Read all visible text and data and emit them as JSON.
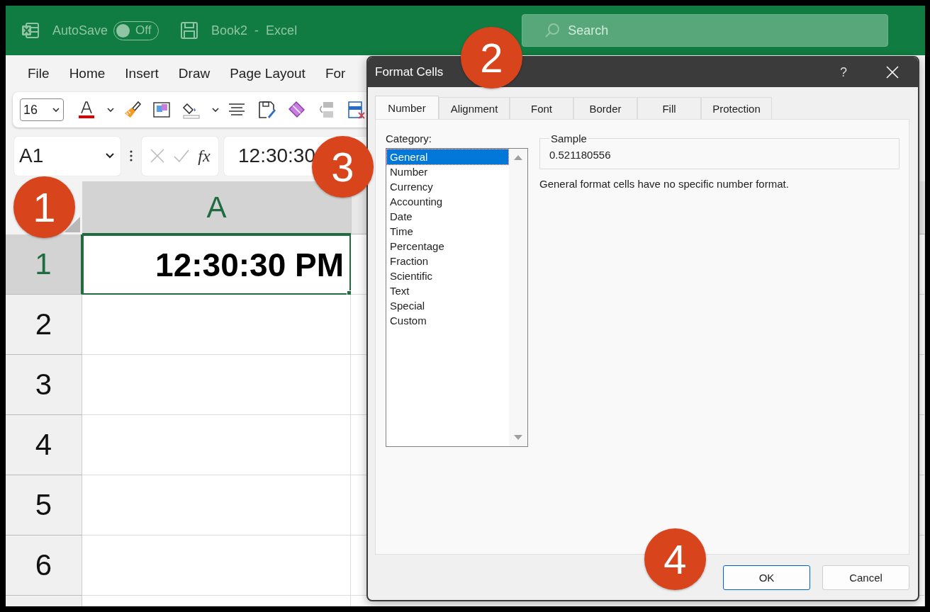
{
  "title_bar": {
    "autosave_label": "AutoSave",
    "autosave": {
      "on": false,
      "label": "Off"
    },
    "document": "Book2",
    "separator": "-",
    "app": "Excel",
    "search": {
      "placeholder": "Search"
    }
  },
  "menu": [
    {
      "label": "File"
    },
    {
      "label": "Home"
    },
    {
      "label": "Insert"
    },
    {
      "label": "Draw"
    },
    {
      "label": "Page Layout"
    },
    {
      "label": "For"
    }
  ],
  "toolbar": {
    "font_size": "16"
  },
  "formula_bar": {
    "name_box": "A1",
    "function_label": "fx",
    "value": "12:30:30"
  },
  "sheet": {
    "columns": [
      {
        "label": "A",
        "selected": true
      }
    ],
    "rows": [
      {
        "label": "1",
        "selected": true,
        "value": "12:30:30 PM"
      },
      {
        "label": "2",
        "selected": false
      },
      {
        "label": "3",
        "selected": false
      },
      {
        "label": "4",
        "selected": false
      },
      {
        "label": "5",
        "selected": false
      },
      {
        "label": "6",
        "selected": false
      }
    ]
  },
  "dialog": {
    "title": "Format Cells",
    "help": "?",
    "tabs": [
      {
        "label": "Number",
        "selected": true
      },
      {
        "label": "Alignment",
        "selected": false
      },
      {
        "label": "Font",
        "selected": false
      },
      {
        "label": "Border",
        "selected": false
      },
      {
        "label": "Fill",
        "selected": false
      },
      {
        "label": "Protection",
        "selected": false
      }
    ],
    "category_label": "Category:",
    "categories": [
      {
        "label": "General",
        "selected": true
      },
      {
        "label": "Number",
        "selected": false
      },
      {
        "label": "Currency",
        "selected": false
      },
      {
        "label": "Accounting",
        "selected": false
      },
      {
        "label": "Date",
        "selected": false
      },
      {
        "label": "Time",
        "selected": false
      },
      {
        "label": "Percentage",
        "selected": false
      },
      {
        "label": "Fraction",
        "selected": false
      },
      {
        "label": "Scientific",
        "selected": false
      },
      {
        "label": "Text",
        "selected": false
      },
      {
        "label": "Special",
        "selected": false
      },
      {
        "label": "Custom",
        "selected": false
      }
    ],
    "sample": {
      "label": "Sample",
      "value": "0.521180556"
    },
    "description": "General format cells have no specific number format.",
    "buttons": [
      {
        "label": "OK",
        "default": true
      },
      {
        "label": "Cancel",
        "default": false
      }
    ]
  },
  "callouts": [
    {
      "label": "1"
    },
    {
      "label": "2"
    },
    {
      "label": "3"
    },
    {
      "label": "4"
    }
  ]
}
